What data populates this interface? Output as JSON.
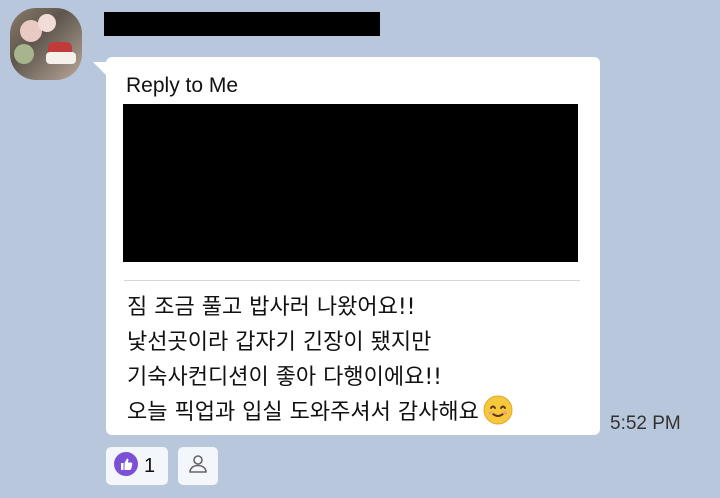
{
  "message": {
    "reply_label": "Reply to Me",
    "lines": [
      "짐 조금 풀고 밥사러 나왔어요!!",
      "낯선곳이라 갑자기 긴장이 됐지만",
      "기숙사컨디션이 좋아 다행이에요!!",
      "오늘 픽업과 입실 도와주셔서 감사해요"
    ],
    "emoji": "smiling-face-emoji",
    "time": "5:52 PM"
  },
  "reactions": {
    "like_count": "1",
    "like_icon": "thumbs-up-icon",
    "add_icon": "person-icon",
    "like_color": "#7b4fd6"
  },
  "colors": {
    "background": "#b8c7db",
    "bubble": "#ffffff"
  }
}
